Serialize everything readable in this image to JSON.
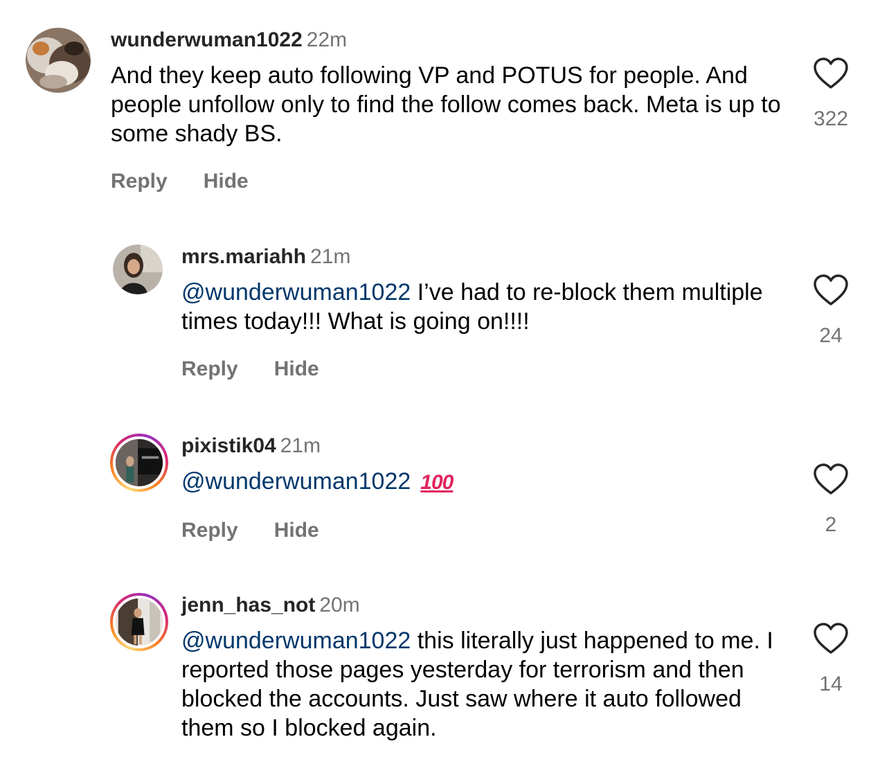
{
  "comments": [
    {
      "username": "wunderwuman1022",
      "time": "22m",
      "mention": "",
      "text": "And they keep auto following VP and POTUS for people. And people unfollow only to find the follow comes back. Meta is up to some shady BS.",
      "emoji": "",
      "reply_label": "Reply",
      "hide_label": "Hide",
      "likes": "322",
      "like_icon": "heart-outline-icon",
      "avatar_ring": false
    },
    {
      "username": "mrs.mariahh",
      "time": "21m",
      "mention": "@wunderwuman1022",
      "text": "I’ve had to re-block them multiple times today!!! What is going on!!!!",
      "emoji": "",
      "reply_label": "Reply",
      "hide_label": "Hide",
      "likes": "24",
      "like_icon": "heart-outline-icon",
      "avatar_ring": false
    },
    {
      "username": "pixistik04",
      "time": "21m",
      "mention": "@wunderwuman1022",
      "text": "",
      "emoji": "100",
      "reply_label": "Reply",
      "hide_label": "Hide",
      "likes": "2",
      "like_icon": "heart-outline-icon",
      "avatar_ring": true
    },
    {
      "username": "jenn_has_not",
      "time": "20m",
      "mention": "@wunderwuman1022",
      "text": "this literally just happened to me. I reported those pages yesterday for terrorism and then blocked the accounts. Just saw where it auto followed them so I blocked again.",
      "emoji": "",
      "reply_label": "Reply",
      "hide_label": "Hide",
      "likes": "14",
      "like_icon": "heart-outline-icon",
      "avatar_ring": true
    }
  ],
  "colors": {
    "mention": "#00376b",
    "secondary_text": "#737373",
    "username": "#262626",
    "emoji_100": "#e0245e"
  }
}
